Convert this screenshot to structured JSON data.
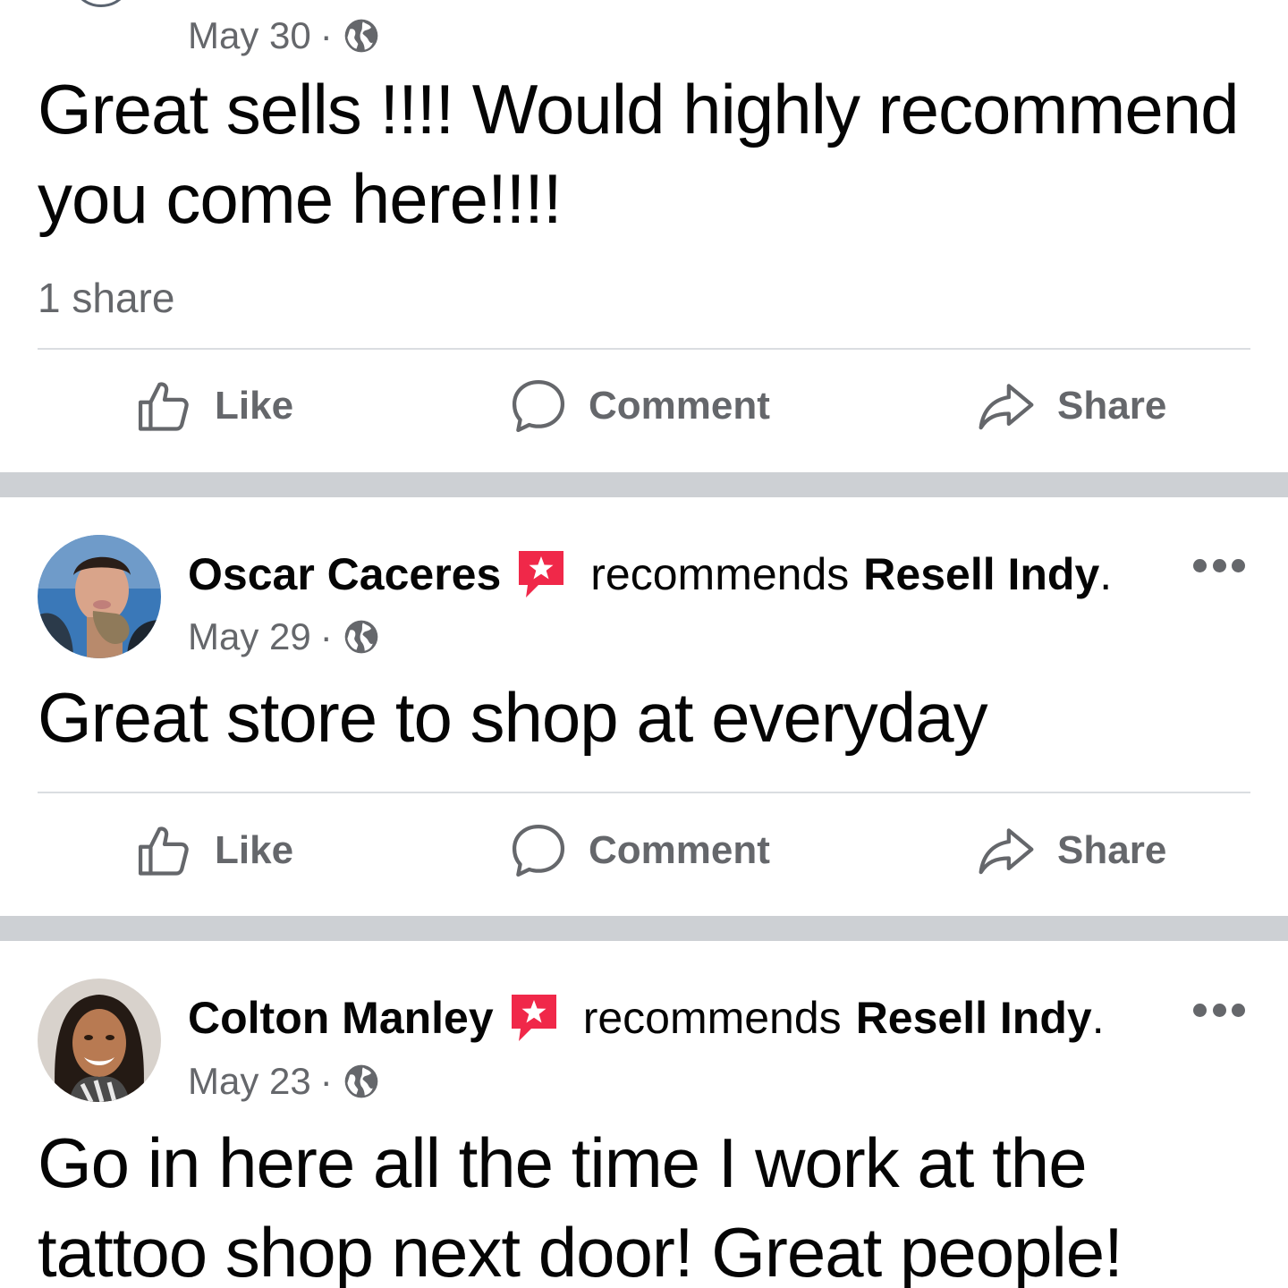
{
  "posts": [
    {
      "date": "May 30",
      "separator": "·",
      "body": "Great sells !!!! Would highly recommend you come here!!!!",
      "shares": "1 share",
      "actions": {
        "like": "Like",
        "comment": "Comment",
        "share": "Share"
      }
    },
    {
      "author": "Oscar Caceres",
      "verb": "recommends",
      "page": "Resell Indy",
      "page_suffix": ".",
      "date": "May 29",
      "separator": "·",
      "body": "Great store to shop at everyday",
      "actions": {
        "like": "Like",
        "comment": "Comment",
        "share": "Share"
      }
    },
    {
      "author": "Colton Manley",
      "verb": "recommends",
      "page": "Resell Indy",
      "page_suffix": ".",
      "date": "May 23",
      "separator": "·",
      "body": "Go in here all the time I work at the tattoo shop next door! Great people!"
    }
  ],
  "colors": {
    "recommend_badge": "#f02849",
    "secondary_text": "#65676b",
    "primary_text": "#050505",
    "divider": "#dadde1",
    "section_separator": "#cdd0d4"
  },
  "icons": {
    "globe": "globe-icon",
    "recommend": "recommend-star-icon",
    "like": "thumbs-up-icon",
    "comment": "comment-bubble-icon",
    "share": "share-arrow-icon",
    "more": "more-options-icon"
  }
}
